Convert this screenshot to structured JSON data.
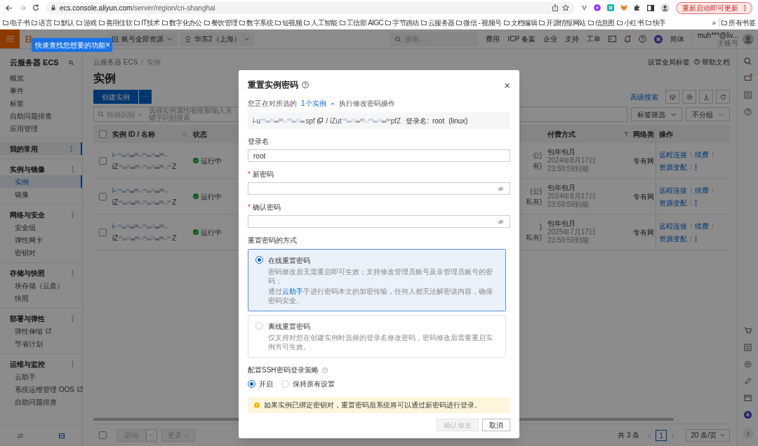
{
  "browser": {
    "url_host": "ecs.console.aliyun.com",
    "url_path": "/server/region/cn-shanghai",
    "forward_disabled": true,
    "update_button": "重新启动即可更新",
    "bookmarks": [
      "电子书",
      "语言",
      "默认",
      "游戏",
      "善用佳软",
      "IT技术",
      "数字化办公",
      "餐饮管理",
      "数字系统",
      "短视频",
      "人工智能",
      "工信部 AIGC",
      "字节跳动",
      "云服务器",
      "微信 - 视频号",
      "文档编辑",
      "开源情报网站",
      "信息图",
      "小红书",
      "快手"
    ],
    "more_bookmarks": "»",
    "all_bookmarks": "所有书签"
  },
  "topbar": {
    "tooltip": "快速查找您想要的功能",
    "tooltip_close": "×",
    "account_scope": "账号全部资源",
    "region": "华东2（上海）",
    "search_placeholder": "搜索...",
    "links": [
      "费用",
      "ICP 备案",
      "企业",
      "支持",
      "工单"
    ],
    "has_notification": true,
    "language": "简体",
    "user": "muh***@liv...",
    "account_type": "主账号"
  },
  "sidebar": {
    "title": "云服务器 ECS",
    "items": [
      {
        "label": "概览",
        "selected": false
      },
      {
        "label": "事件",
        "selected": false
      },
      {
        "label": "标签",
        "selected": false
      },
      {
        "label": "自助问题排查",
        "selected": false
      },
      {
        "label": "应用管理",
        "selected": false
      }
    ],
    "groups": [
      {
        "label": "我的常用",
        "selected": true
      },
      {
        "label": "实例与镜像",
        "selected": false,
        "items": [
          {
            "label": "实例",
            "selected": true,
            "external": false
          },
          {
            "label": "镜像",
            "selected": false,
            "external": false
          }
        ]
      },
      {
        "label": "网络与安全",
        "selected": false,
        "items": [
          {
            "label": "安全组",
            "selected": false,
            "external": false
          },
          {
            "label": "弹性网卡",
            "selected": false,
            "external": false
          },
          {
            "label": "密钥对",
            "selected": false,
            "external": false
          }
        ]
      },
      {
        "label": "存储与快照",
        "selected": false,
        "items": [
          {
            "label": "块存储（云盘）",
            "selected": false,
            "external": false
          },
          {
            "label": "快照",
            "selected": false,
            "external": false
          }
        ]
      },
      {
        "label": "部署与弹性",
        "selected": false,
        "items": [
          {
            "label": "弹性伸缩",
            "selected": false,
            "external": true
          },
          {
            "label": "节省计划",
            "selected": false,
            "external": false
          }
        ]
      },
      {
        "label": "运维与监控",
        "selected": false,
        "items": [
          {
            "label": "云助手",
            "selected": false,
            "external": false
          },
          {
            "label": "系统运维管理 OOS",
            "selected": false,
            "external": true
          },
          {
            "label": "自助问题排查",
            "selected": false,
            "external": false
          }
        ]
      }
    ]
  },
  "main": {
    "breadcrumb": [
      "云服务器 ECS",
      "实例"
    ],
    "breadcrumb_separator": "/",
    "title": "实例",
    "create_button": "创建实例",
    "more_button": "···",
    "search_filter": "自动识别",
    "search_placeholder": "选择实例属性项搜索/输入关键字识别搜索",
    "global_tags": "设置全局标签",
    "help_docs": "帮助文档",
    "advanced_search": "高级搜索",
    "tag_filter": "标签筛选",
    "grouping": "不分组"
  },
  "table": {
    "header_checked": false,
    "columns": [
      "实例 ID / 名称",
      "状态",
      "付费方式",
      "网络类",
      "操作"
    ],
    "rows": [
      {
        "checked": false,
        "id_start": "i-",
        "name_start": "iZ",
        "name_end": "Z",
        "status": "运行中",
        "column_3": [
          "公)",
          "有)"
        ],
        "billing": "包年包月",
        "expiry": "2024年8月17日 23:59:59到期",
        "network": "专有网",
        "actions": [
          "远程连接",
          "续费",
          "资源变配"
        ]
      },
      {
        "checked": false,
        "id_start": "i-",
        "name_start": "iZ",
        "name_end": "Z",
        "status": "运行中",
        "column_3": [
          "(公)",
          "私有)"
        ],
        "billing": "包年包月",
        "expiry": "2024年8月17日 23:59:59到期",
        "network": "专有网",
        "actions": [
          "远程连接",
          "续费",
          "资源变配"
        ]
      },
      {
        "checked": false,
        "id_start": "i-",
        "name_start": "iZ",
        "name_end": "Z",
        "status": "运行中",
        "column_3": [
          ")",
          "私有)"
        ],
        "billing": "包年包月",
        "expiry": "2025年7月17日 23:59:59到期",
        "network": "专有网",
        "actions": [
          "远程连接",
          "续费",
          "资源变配"
        ]
      }
    ]
  },
  "footer": {
    "select_all_checked": false,
    "start_disabled": true,
    "more_menu_disabled": true,
    "start_button": "启动",
    "more_button": "···",
    "more_menu": "更多",
    "total": "共 3 条",
    "pages": [
      {
        "label": "1",
        "selected": true
      }
    ],
    "page_size": "20 条/页"
  },
  "dialog": {
    "title": "重置实例密码",
    "close": "×",
    "scope_prefix": "您正在对所选的",
    "scope_link": "1个实例",
    "scope_suffix": "执行修改密码操作",
    "instance": {
      "id_start": "i-u",
      "id_end": "spf",
      "name_start": "/ iZut",
      "name_end": "pfZ",
      "login_label": "登录名:",
      "login": "root",
      "os": "(linux)"
    },
    "required_mark": "*",
    "fields": [
      {
        "label": "登录名",
        "required": false,
        "kind": "text",
        "value": "root"
      },
      {
        "label": "新密码",
        "required": true,
        "kind": "password"
      },
      {
        "label": "确认密码",
        "required": true,
        "kind": "password"
      }
    ],
    "method_label": "重置密码的方式",
    "methods": [
      {
        "title": "在线重置密码",
        "selected": true,
        "description": "密码修改后无需重启即可生效；支持修改管理员账号及非管理员账号的密码；",
        "note": {
          "before": "通过",
          "link": "云助手",
          "after": "手进行密码本文的加密传输，任何人都无法解密该内容，确保密码安全。"
        }
      },
      {
        "title": "离线重置密码",
        "selected": false,
        "description": "仅支持对您在创建实例时选择的登录名修改密码，密码修改后需要重启实例方可生效。"
      }
    ],
    "ssh_label": "配置SSH密码登录策略",
    "ssh_options": [
      {
        "label": "开启",
        "selected": true
      },
      {
        "label": "保持原有设置",
        "selected": false
      }
    ],
    "warning": "如果实例已绑定密钥对，重置密码后系统将可以通过新密码进行登录。",
    "buttons": [
      {
        "label": "确认修改",
        "disabled": true
      },
      {
        "label": "取消",
        "disabled": false
      }
    ]
  }
}
